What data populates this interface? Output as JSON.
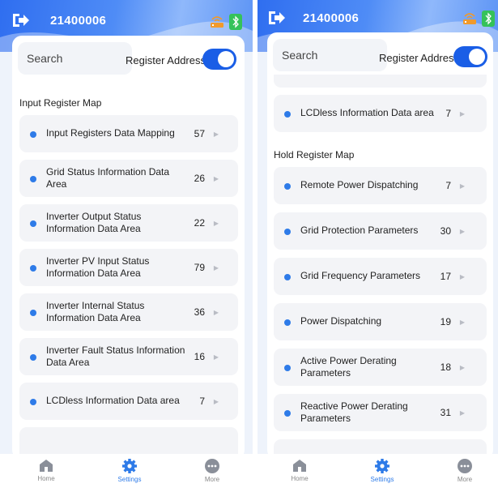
{
  "colors": {
    "accent": "#2e7be8",
    "toggle": "#1a5ee6",
    "bluetooth": "#35c25a",
    "router": "#f19a2b"
  },
  "screens": [
    {
      "header": {
        "device_id": "21400006",
        "icons": [
          "exit-icon",
          "router-icon",
          "bluetooth-icon"
        ]
      },
      "search": {
        "placeholder": "Search"
      },
      "register_toggle": {
        "label": "Register Address",
        "on": true
      },
      "sections": [
        {
          "title": "Input Register Map"
        }
      ],
      "items": [
        {
          "label": "Input Registers Data Mapping",
          "count": "57"
        },
        {
          "label": "Grid Status Information Data Area",
          "count": "26"
        },
        {
          "label": "Inverter Output Status Information Data Area",
          "count": "22"
        },
        {
          "label": "Inverter PV Input Status Information Data Area",
          "count": "79"
        },
        {
          "label": "Inverter Internal Status Information Data Area",
          "count": "36"
        },
        {
          "label": "Inverter Fault Status Information Data Area",
          "count": "16"
        },
        {
          "label": "LCDless Information Data area",
          "count": "7"
        }
      ],
      "tabs": [
        {
          "label": "Home",
          "icon": "home-icon",
          "active": false
        },
        {
          "label": "Settings",
          "icon": "settings-icon",
          "active": true
        },
        {
          "label": "More",
          "icon": "more-icon",
          "active": false
        }
      ]
    },
    {
      "header": {
        "device_id": "21400006",
        "icons": [
          "exit-icon",
          "router-icon",
          "bluetooth-icon"
        ]
      },
      "search": {
        "placeholder": "Search"
      },
      "register_toggle": {
        "label": "Register Address",
        "on": true
      },
      "sections": [
        {
          "title": "Hold Register Map"
        }
      ],
      "items": [
        {
          "label": "LCDless Information Data area",
          "count": "7"
        },
        {
          "label": "Remote Power Dispatching",
          "count": "7"
        },
        {
          "label": "Grid Protection Parameters",
          "count": "30"
        },
        {
          "label": "Grid Frequency Parameters",
          "count": "17"
        },
        {
          "label": "Power Dispatching",
          "count": "19"
        },
        {
          "label": "Active Power Derating Parameters",
          "count": "18"
        },
        {
          "label": "Reactive Power Derating Parameters",
          "count": "31"
        }
      ],
      "tabs": [
        {
          "label": "Home",
          "icon": "home-icon",
          "active": false
        },
        {
          "label": "Settings",
          "icon": "settings-icon",
          "active": true
        },
        {
          "label": "More",
          "icon": "more-icon",
          "active": false
        }
      ]
    }
  ]
}
